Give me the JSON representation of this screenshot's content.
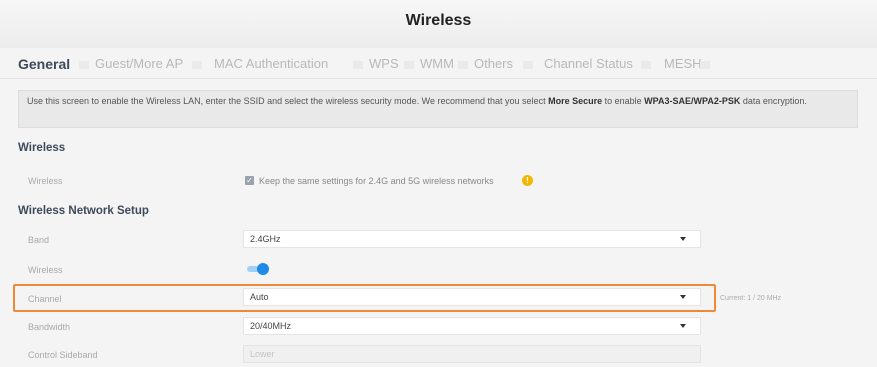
{
  "page": {
    "title": "Wireless"
  },
  "tabs": [
    {
      "label": "General",
      "active": true
    },
    {
      "label": "Guest/More AP",
      "active": false
    },
    {
      "label": "MAC Authentication",
      "active": false
    },
    {
      "label": "WPS",
      "active": false
    },
    {
      "label": "WMM",
      "active": false
    },
    {
      "label": "Others",
      "active": false
    },
    {
      "label": "Channel Status",
      "active": false
    },
    {
      "label": "MESH",
      "active": false
    }
  ],
  "info": {
    "text_before": "Use this screen to enable the Wireless LAN, enter the SSID and select the wireless security mode. We recommend that you select ",
    "bold1": "More Secure",
    "text_middle": " to enable ",
    "bold2": "WPA3-SAE/WPA2-PSK",
    "text_after": " data encryption."
  },
  "wireless_section": {
    "heading": "Wireless",
    "label": "Wireless",
    "checkbox_checked": true,
    "checkbox_text": "Keep the same settings for 2.4G and 5G wireless networks",
    "info_icon": "info-icon"
  },
  "setup_section": {
    "heading": "Wireless Network Setup",
    "band": {
      "label": "Band",
      "value": "2.4GHz"
    },
    "wireless": {
      "label": "Wireless",
      "enabled": true
    },
    "channel": {
      "label": "Channel",
      "value": "Auto",
      "current": "Current: 1 / 20 MHz"
    },
    "bandwidth": {
      "label": "Bandwidth",
      "value": "20/40MHz"
    },
    "control_sideband": {
      "label": "Control Sideband",
      "value": "Lower"
    }
  },
  "colors": {
    "highlight": "#f08a3a",
    "toggle": "#1e8be8",
    "active_tab": "#3e4a59"
  }
}
